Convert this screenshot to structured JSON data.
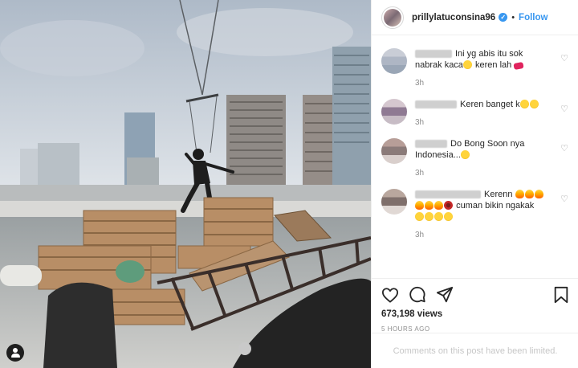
{
  "post": {
    "username": "prillylatuconsina96",
    "follow_label": "Follow",
    "separator": "•",
    "views": "673,198 views",
    "time_ago": "5 HOURS AGO",
    "footer_note": "Comments on this post have been limited.",
    "colors": {
      "accent": "#3897f0",
      "muted": "#8e8e8e",
      "border": "#efefef"
    }
  },
  "comments": [
    {
      "line1": "Ini yg abis itu sok",
      "line2": "nabrak kaca",
      "line2_tail": " keren lah",
      "time": "3h",
      "avatar_colors": [
        "#c9cdd6",
        "#aeb6c4",
        "#9aa6b6"
      ]
    },
    {
      "text": "Keren banget k",
      "time": "3h",
      "avatar_colors": [
        "#d5c7cf",
        "#8f7a93",
        "#c7bcc5"
      ]
    },
    {
      "text": "Do Bong Soon nya",
      "line2": "Indonesia...",
      "time": "3h",
      "avatar_colors": [
        "#b79e98",
        "#8b7b79",
        "#d9cfcc"
      ]
    },
    {
      "text": "Kerenn",
      "line2": "cuman bikin ngakak",
      "time": "3h",
      "avatar_colors": [
        "#b9a79e",
        "#7f6f6b",
        "#e0d8d4"
      ]
    }
  ],
  "icons": [
    "like-icon",
    "comment-icon",
    "share-icon",
    "bookmark-icon",
    "heart-icon",
    "verified-icon",
    "user-tag-icon"
  ]
}
